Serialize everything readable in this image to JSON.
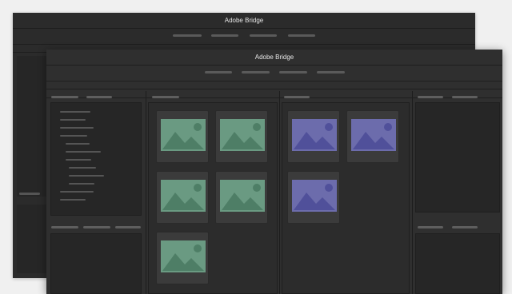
{
  "back_window": {
    "title": "Adobe Bridge"
  },
  "front_window": {
    "title": "Adobe Bridge"
  },
  "colors": {
    "green_thumb_bg": "#6a9a82",
    "green_thumb_fg": "#5a8a72",
    "blue_thumb_bg": "#6a6aa8",
    "blue_thumb_fg": "#5a5a98"
  },
  "icons": {
    "thumbnail": "image-placeholder-icon"
  }
}
